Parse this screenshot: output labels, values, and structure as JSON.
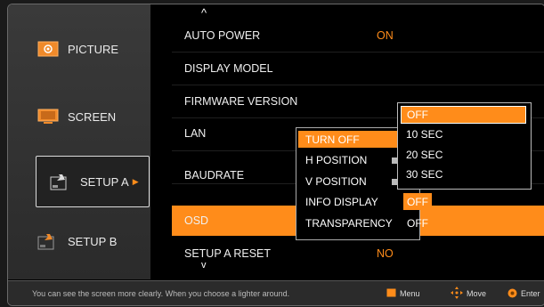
{
  "sidebar": {
    "items": [
      {
        "label": "PICTURE",
        "icon": "picture-icon"
      },
      {
        "label": "SCREEN",
        "icon": "screen-icon"
      },
      {
        "label": "SETUP A",
        "icon": "setup-a-icon",
        "active": true
      },
      {
        "label": "SETUP B",
        "icon": "setup-b-icon"
      }
    ],
    "active_arrow": "▶"
  },
  "menu": {
    "scroll_up": "^",
    "scroll_down": "v",
    "rows": [
      {
        "label": "AUTO POWER",
        "value": "ON"
      },
      {
        "label": "DISPLAY MODEL",
        "value": ""
      },
      {
        "label": "FIRMWARE VERSION",
        "value": ""
      },
      {
        "label": "LAN",
        "value": ""
      },
      {
        "label": "BAUDRATE",
        "value": ""
      },
      {
        "label": "OSD",
        "value": "",
        "selected": true
      },
      {
        "label": "SETUP A RESET",
        "value": "NO"
      }
    ]
  },
  "osd_submenu": {
    "items": [
      "TURN OFF",
      "H POSITION",
      "V POSITION",
      "INFO DISPLAY",
      "TRANSPARENCY"
    ],
    "info_display_value": "OFF",
    "transparency_value": "OFF"
  },
  "turn_off_dropdown": {
    "options": [
      "OFF",
      "10 SEC",
      "20 SEC",
      "30 SEC"
    ],
    "selected_index": 0
  },
  "footer": {
    "hint": "You can see the screen more clearly.  When you choose a lighter around.",
    "keys": [
      {
        "label": "Menu",
        "icon": "menu-key-icon"
      },
      {
        "label": "Move",
        "icon": "move-key-icon"
      },
      {
        "label": "Enter",
        "icon": "enter-key-icon"
      }
    ]
  },
  "colors": {
    "accent": "#ff8c1a",
    "background": "#000000",
    "sidebar": "#2f2f2f"
  }
}
